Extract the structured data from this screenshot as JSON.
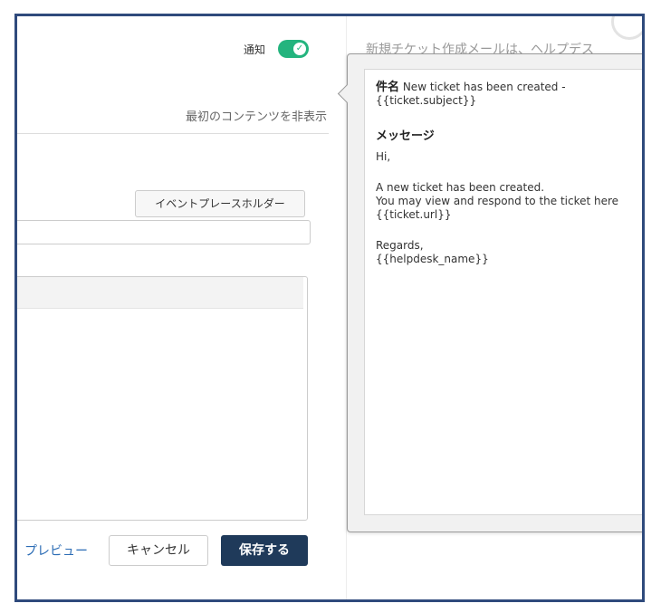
{
  "header": {
    "notify_label": "通知",
    "toggle_on": true,
    "hide_first_content": "最初のコンテンツを非表示"
  },
  "form": {
    "placeholder_button": "イベントプレースホルダー",
    "subject_value": "",
    "preview_link": "プレビュー",
    "cancel_button": "キャンセル",
    "save_button": "保存する"
  },
  "right_column": {
    "behind_text": "新規チケット作成メールは、ヘルプデス"
  },
  "popover": {
    "subject_label": "件名",
    "subject_text": " New ticket has been created - {{ticket.subject}}",
    "message_label": "メッセージ",
    "message_lines": [
      "Hi,",
      "",
      "A new ticket has been created.",
      "You may view and respond to the ticket here {{ticket.url}}",
      "",
      "Regards,",
      "{{helpdesk_name}}"
    ]
  },
  "colors": {
    "frame_border": "#2f4a7c",
    "toggle_on": "#24b47e",
    "link": "#2b6cb5",
    "primary_button": "#1f3a5a"
  }
}
